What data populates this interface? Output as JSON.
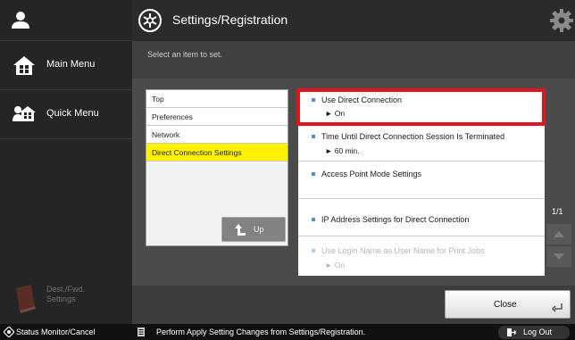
{
  "left_panel": {
    "main_menu_label": "Main Menu",
    "quick_menu_label": "Quick Menu",
    "dest_label_line1": "Dest./Fwd.",
    "dest_label_line2": "Settings"
  },
  "header": {
    "title": "Settings/Registration"
  },
  "subheader": {
    "instruction": "Select an item to set."
  },
  "tree": {
    "items": [
      {
        "label": "Top"
      },
      {
        "label": "Preferences"
      },
      {
        "label": "Network"
      },
      {
        "label": "Direct Connection Settings"
      }
    ],
    "selected": "Direct Connection Settings",
    "up_label": "Up"
  },
  "settings_list": {
    "items": [
      {
        "name": "Use Direct Connection",
        "value": "► On"
      },
      {
        "name": "Time Until Direct Connection Session Is Terminated",
        "value": "► 60 min."
      },
      {
        "name": "Access Point Mode Settings",
        "value": ""
      },
      {
        "name": "IP Address Settings for Direct Connection",
        "value": ""
      },
      {
        "name": "Use Login Name as User Name for Print Jobs",
        "value": "► On"
      }
    ]
  },
  "pagination": {
    "indicator": "1/1"
  },
  "actions": {
    "close_label": "Close"
  },
  "status_bar": {
    "status_monitor_label": "Status Monitor/Cancel",
    "message": "Perform Apply Setting Changes from Settings/Registration.",
    "logout_label": "Log Out"
  },
  "colors": {
    "selected_item": "#fff200",
    "highlight_box": "#e3141c",
    "bullet": "#4a8fd6"
  }
}
